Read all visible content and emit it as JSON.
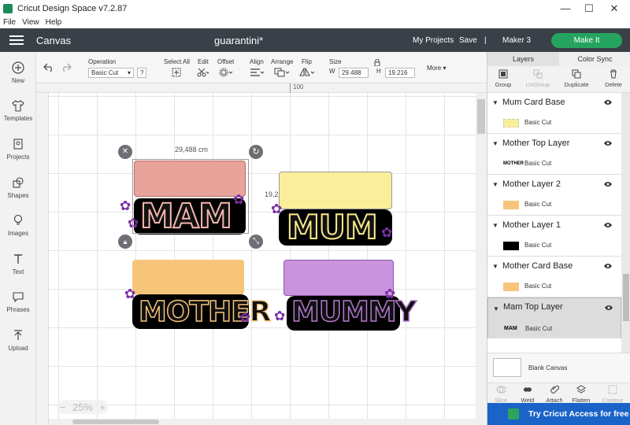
{
  "window": {
    "title": "Cricut Design Space  v7.2.87",
    "minimize": "—",
    "maximize": "☐",
    "close": "✕"
  },
  "menu": [
    "File",
    "View",
    "Help"
  ],
  "header": {
    "section": "Canvas",
    "project_name": "guarantini*",
    "my_projects": "My Projects",
    "save": "Save",
    "separator": "|",
    "machine": "Maker 3",
    "make_it": "Make It"
  },
  "left_nav": [
    {
      "label": "New",
      "icon": "plus-circle-icon"
    },
    {
      "label": "Templates",
      "icon": "tshirt-icon"
    },
    {
      "label": "Projects",
      "icon": "projects-icon"
    },
    {
      "label": "Shapes",
      "icon": "shapes-icon"
    },
    {
      "label": "Images",
      "icon": "lightbulb-icon"
    },
    {
      "label": "Text",
      "icon": "text-icon"
    },
    {
      "label": "Phrases",
      "icon": "speech-bubble-icon"
    },
    {
      "label": "Upload",
      "icon": "upload-icon"
    }
  ],
  "toolbar": {
    "operation_label": "Operation",
    "operation_value": "Basic Cut",
    "help": "?",
    "select_all": "Select All",
    "edit": "Edit",
    "offset": "Offset",
    "align": "Align",
    "arrange": "Arrange",
    "flip": "Flip",
    "size": "Size",
    "w_label": "W",
    "w_value": "29.488",
    "h_label": "H",
    "h_value": "19.216",
    "more": "More"
  },
  "ruler": {
    "mark": "100"
  },
  "canvas": {
    "width_dim": "29,488 cm",
    "height_dim": "19,216 cm",
    "zoom": "25%",
    "zoom_minus": "−",
    "zoom_plus": "+",
    "designs": [
      {
        "word": "MAM",
        "top_color": "#e8a39b",
        "outline": "#f4b5ae"
      },
      {
        "word": "MUM",
        "top_color": "#fbee9a",
        "outline": "#f8ea8a"
      },
      {
        "word": "MOTHER",
        "top_color": "#f7c57a",
        "outline": "#f7c57a"
      },
      {
        "word": "MUMMY",
        "top_color": "#c993df",
        "outline": "#b47ad0"
      }
    ]
  },
  "panel": {
    "tab_layers": "Layers",
    "tab_color_sync": "Color Sync",
    "tools": [
      {
        "label": "Group",
        "enabled": true
      },
      {
        "label": "UnGroup",
        "enabled": false
      },
      {
        "label": "Duplicate",
        "enabled": true
      },
      {
        "label": "Delete",
        "enabled": true
      }
    ],
    "layers": [
      {
        "name": "Mum Card Base",
        "op": "Basic Cut",
        "swatch": "#fbee9a",
        "selected": false
      },
      {
        "name": "Mother Top Layer",
        "op": "Basic Cut",
        "swatch_text": "MOTHER",
        "selected": false
      },
      {
        "name": "Mother Layer 2",
        "op": "Basic Cut",
        "swatch": "#f7c57a",
        "selected": false
      },
      {
        "name": "Mother Layer 1",
        "op": "Basic Cut",
        "swatch": "#000000",
        "selected": false
      },
      {
        "name": "Mother Card Base",
        "op": "Basic Cut",
        "swatch": "#f7c57a",
        "selected": false
      },
      {
        "name": "Mam Top Layer",
        "op": "Basic Cut",
        "swatch_text": "MAM",
        "selected": true
      }
    ],
    "blank_canvas": "Blank Canvas",
    "bottom_tools": [
      {
        "label": "Slice",
        "enabled": false
      },
      {
        "label": "Weld",
        "enabled": true
      },
      {
        "label": "Attach",
        "enabled": true
      },
      {
        "label": "Flatten",
        "enabled": true
      },
      {
        "label": "Contour",
        "enabled": false
      }
    ],
    "promo": "Try Cricut Access for free"
  }
}
